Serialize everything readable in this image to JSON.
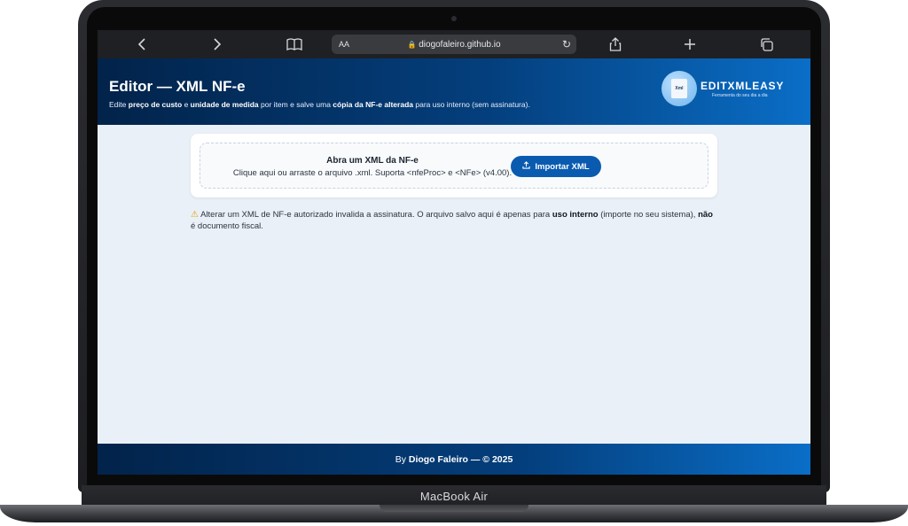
{
  "device": {
    "label": "MacBook Air"
  },
  "browser": {
    "aa_label": "AA",
    "url": "diogofaleiro.github.io",
    "icons": [
      "back-icon",
      "forward-icon",
      "bookmarks-icon",
      "lock-icon",
      "reload-icon",
      "share-icon",
      "new-tab-icon",
      "tabs-icon"
    ]
  },
  "header": {
    "title": "Editor — XML NF-e",
    "subtitle": {
      "p1": "Edite ",
      "b1": "preço de custo",
      "p2": " e ",
      "b2": "unidade de medida",
      "p3": " por item e salve uma ",
      "b3": "cópia da NF-e alterada",
      "p4": " para uso interno (sem assinatura)."
    },
    "logo": {
      "icon_text": "Xml",
      "wordmark": "EDITXMLEASY",
      "tagline": "Ferramenta do seu dia a dia"
    }
  },
  "import": {
    "title": "Abra um XML da NF-e",
    "subtitle": "Clique aqui ou arraste o arquivo .xml. Suporta <nfeProc> e <NFe> (v4.00).",
    "button_label": "Importar XML"
  },
  "warning": {
    "p1": "Alterar um XML de NF-e autorizado invalida a assinatura. O arquivo salvo aqui é apenas para ",
    "b1": "uso interno",
    "p2": " (importe no seu sistema), ",
    "b2": "não",
    "p3": " é documento fiscal."
  },
  "footer": {
    "prefix": "By ",
    "author": "Diogo Faleiro",
    "suffix": " — © 2025"
  },
  "colors": {
    "header_dark": "#02234a",
    "header_light": "#0a6ec7",
    "button": "#0a5bb0",
    "page_bg": "#eaf0f7"
  }
}
